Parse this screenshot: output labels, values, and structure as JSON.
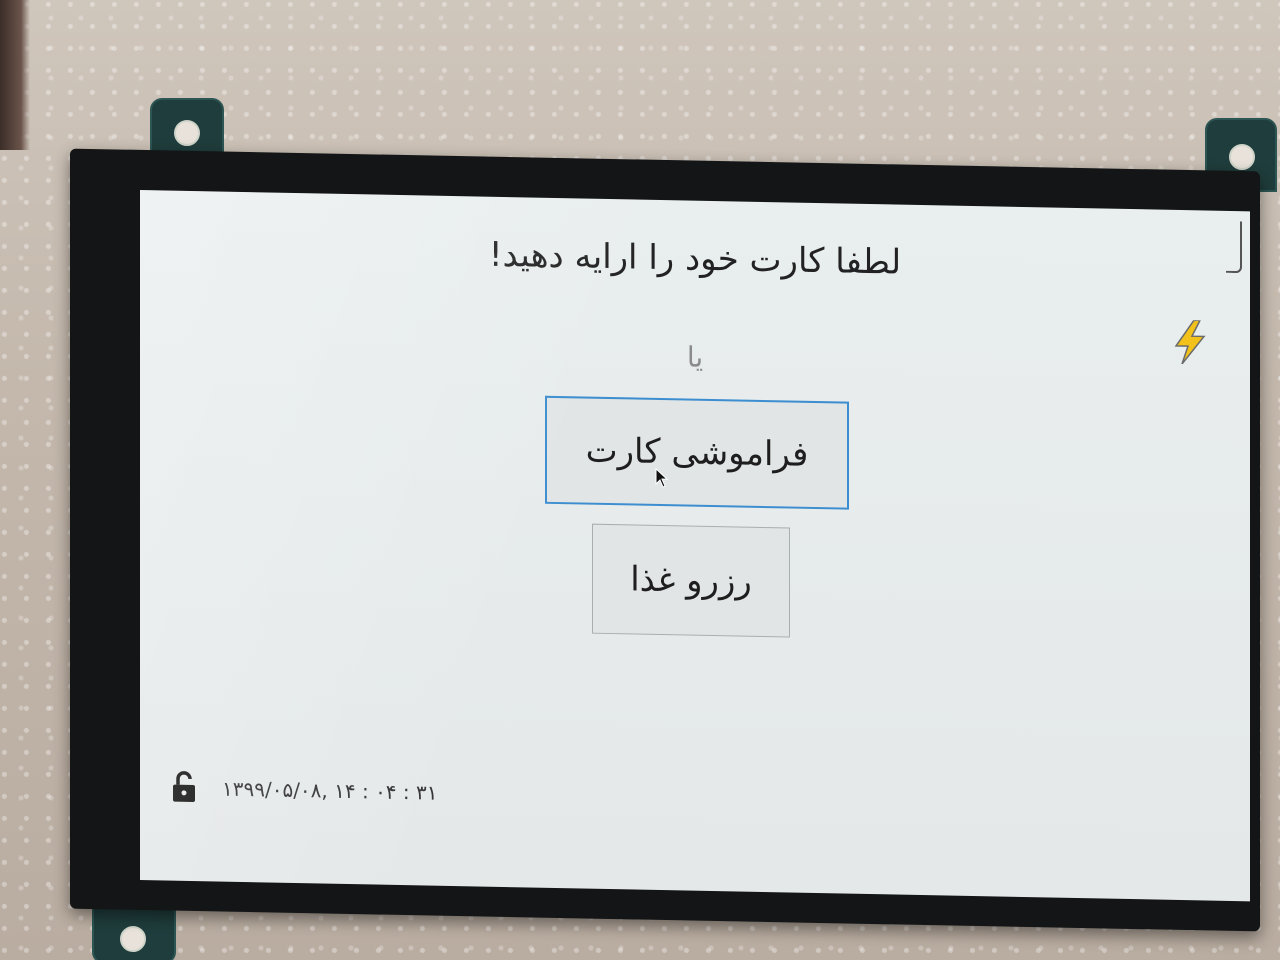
{
  "screen": {
    "title": "لطفا کارت خود را ارایه دهید!",
    "or_text": "یا",
    "buttons": {
      "forgot_card": "فراموشی کارت",
      "reserve_food": "رزرو غذا"
    },
    "status": {
      "datetime": "۱۳۹۹/۰۵/۰۸, ۱۴ : ۰۴ : ۳۱"
    },
    "icons": {
      "power": "lightning-bolt-icon",
      "lock": "unlocked-padlock-icon",
      "cursor": "mouse-pointer-icon"
    },
    "colors": {
      "screen_background": "#e6eaea",
      "focus_border": "#3d8ed0",
      "bolt": "#f2c21a",
      "button_background": "#e1e5e5"
    }
  }
}
